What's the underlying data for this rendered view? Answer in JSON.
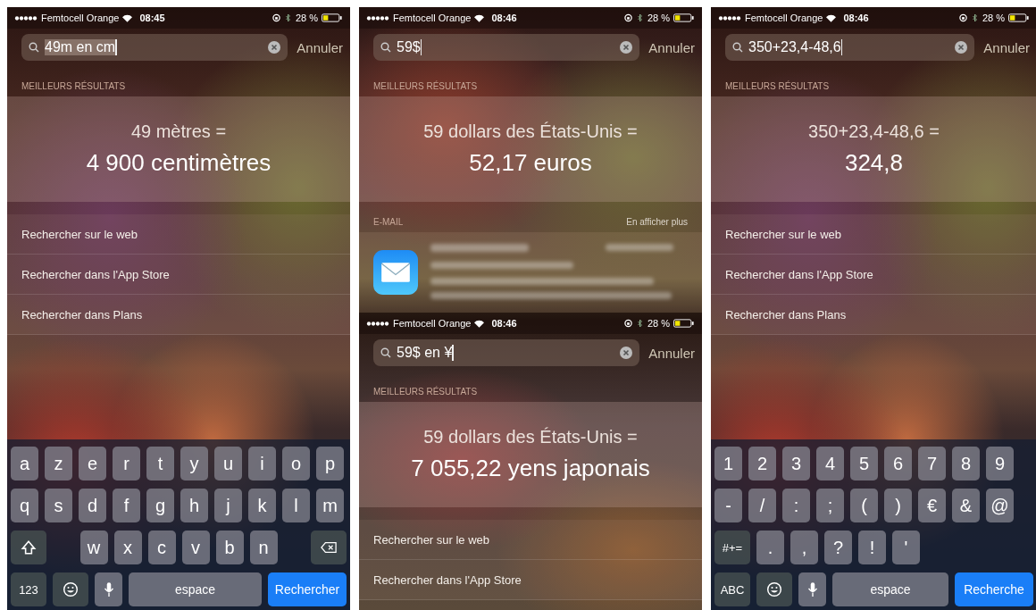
{
  "panels": [
    {
      "blocks": [
        {
          "kind": "status",
          "carrier": "Femtocell Orange",
          "time": "08:45",
          "battery": "28 %"
        },
        {
          "kind": "search",
          "value": "49m en cm",
          "highlighted": true,
          "cancel": "Annuler"
        },
        {
          "kind": "header",
          "title": "MEILLEURS RÉSULTATS"
        },
        {
          "kind": "result",
          "question": "49 mètres =",
          "answer": "4 900 centimètres"
        },
        {
          "kind": "links",
          "items": [
            "Rechercher sur le web",
            "Rechercher dans l'App Store",
            "Rechercher dans Plans"
          ]
        },
        {
          "kind": "keyboard",
          "rows": [
            {
              "keys": [
                {
                  "kind": "char",
                  "label": "a"
                },
                {
                  "kind": "char",
                  "label": "z"
                },
                {
                  "kind": "char",
                  "label": "e"
                },
                {
                  "kind": "char",
                  "label": "r"
                },
                {
                  "kind": "char",
                  "label": "t"
                },
                {
                  "kind": "char",
                  "label": "y"
                },
                {
                  "kind": "char",
                  "label": "u"
                },
                {
                  "kind": "char",
                  "label": "i"
                },
                {
                  "kind": "char",
                  "label": "o"
                },
                {
                  "kind": "char",
                  "label": "p"
                }
              ]
            },
            {
              "keys": [
                {
                  "kind": "char",
                  "label": "q"
                },
                {
                  "kind": "char",
                  "label": "s"
                },
                {
                  "kind": "char",
                  "label": "d"
                },
                {
                  "kind": "char",
                  "label": "f"
                },
                {
                  "kind": "char",
                  "label": "g"
                },
                {
                  "kind": "char",
                  "label": "h"
                },
                {
                  "kind": "char",
                  "label": "j"
                },
                {
                  "kind": "char",
                  "label": "k"
                },
                {
                  "kind": "char",
                  "label": "l"
                },
                {
                  "kind": "char",
                  "label": "m"
                }
              ]
            },
            {
              "keys": [
                {
                  "kind": "shift"
                },
                {
                  "kind": "char",
                  "label": "w"
                },
                {
                  "kind": "char",
                  "label": "x"
                },
                {
                  "kind": "char",
                  "label": "c"
                },
                {
                  "kind": "char",
                  "label": "v"
                },
                {
                  "kind": "char",
                  "label": "b"
                },
                {
                  "kind": "char",
                  "label": "n"
                },
                {
                  "kind": "delete"
                }
              ]
            },
            {
              "keys": [
                {
                  "kind": "mode",
                  "label": "123"
                },
                {
                  "kind": "emoji"
                },
                {
                  "kind": "mic"
                },
                {
                  "kind": "space",
                  "label": "espace"
                },
                {
                  "kind": "go",
                  "label": "Rechercher"
                }
              ]
            }
          ]
        }
      ]
    },
    {
      "blocks": [
        {
          "kind": "status",
          "carrier": "Femtocell Orange",
          "time": "08:46",
          "battery": "28 %"
        },
        {
          "kind": "search",
          "value": "59$",
          "highlighted": false,
          "cancel": "Annuler"
        },
        {
          "kind": "header",
          "title": "MEILLEURS RÉSULTATS"
        },
        {
          "kind": "result",
          "question": "59 dollars des États-Unis =",
          "answer": "52,17 euros"
        },
        {
          "kind": "header",
          "title": "E-MAIL",
          "more": "En afficher plus"
        },
        {
          "kind": "mail"
        },
        {
          "kind": "status",
          "carrier": "Femtocell Orange",
          "time": "08:46",
          "battery": "28 %"
        },
        {
          "kind": "search",
          "value": "59$ en ¥",
          "highlighted": false,
          "cancel": "Annuler"
        },
        {
          "kind": "header",
          "title": "MEILLEURS RÉSULTATS"
        },
        {
          "kind": "result",
          "question": "59 dollars des États-Unis =",
          "answer": "7 055,22 yens japonais"
        },
        {
          "kind": "links",
          "items": [
            "Rechercher sur le web",
            "Rechercher dans l'App Store"
          ]
        }
      ]
    },
    {
      "blocks": [
        {
          "kind": "status",
          "carrier": "Femtocell Orange",
          "time": "08:46",
          "battery": "28 %"
        },
        {
          "kind": "search",
          "value": "350+23,4-48,6",
          "highlighted": false,
          "cancel": "Annuler"
        },
        {
          "kind": "header",
          "title": "MEILLEURS RÉSULTATS"
        },
        {
          "kind": "result",
          "question": "350+23,4-48,6 =",
          "answer": "324,8"
        },
        {
          "kind": "links",
          "items": [
            "Rechercher sur le web",
            "Rechercher dans l'App Store",
            "Rechercher dans Plans"
          ]
        },
        {
          "kind": "keyboard",
          "rows": [
            {
              "keys": [
                {
                  "kind": "char",
                  "label": "1"
                },
                {
                  "kind": "char",
                  "label": "2"
                },
                {
                  "kind": "char",
                  "label": "3"
                },
                {
                  "kind": "char",
                  "label": "4"
                },
                {
                  "kind": "char",
                  "label": "5"
                },
                {
                  "kind": "char",
                  "label": "6"
                },
                {
                  "kind": "char",
                  "label": "7"
                },
                {
                  "kind": "char",
                  "label": "8"
                },
                {
                  "kind": "char",
                  "label": "9"
                }
              ]
            },
            {
              "keys": [
                {
                  "kind": "char",
                  "label": "-"
                },
                {
                  "kind": "char",
                  "label": "/"
                },
                {
                  "kind": "char",
                  "label": ":"
                },
                {
                  "kind": "char",
                  "label": ";"
                },
                {
                  "kind": "char",
                  "label": "("
                },
                {
                  "kind": "char",
                  "label": ")"
                },
                {
                  "kind": "char",
                  "label": "€"
                },
                {
                  "kind": "char",
                  "label": "&"
                },
                {
                  "kind": "char",
                  "label": "@"
                }
              ]
            },
            {
              "keys": [
                {
                  "kind": "mode",
                  "label": "#+="
                },
                {
                  "kind": "char",
                  "label": "."
                },
                {
                  "kind": "char",
                  "label": ","
                },
                {
                  "kind": "char",
                  "label": "?"
                },
                {
                  "kind": "char",
                  "label": "!"
                },
                {
                  "kind": "char",
                  "label": "'"
                }
              ]
            },
            {
              "keys": [
                {
                  "kind": "mode",
                  "label": "ABC"
                },
                {
                  "kind": "emoji"
                },
                {
                  "kind": "mic"
                },
                {
                  "kind": "space",
                  "label": "espace"
                },
                {
                  "kind": "go",
                  "label": "Recherche"
                }
              ]
            }
          ]
        }
      ]
    }
  ]
}
